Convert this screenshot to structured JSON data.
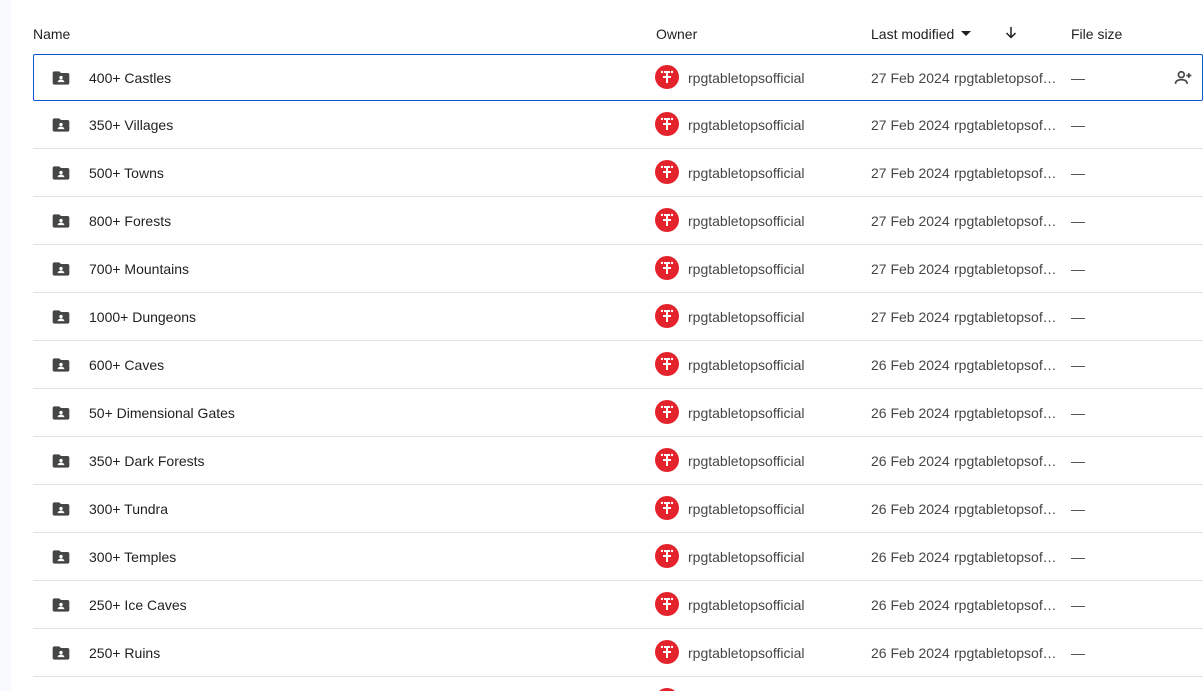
{
  "colors": {
    "accent": "#0b57d0",
    "avatar_red": "#e3222b",
    "folder": "#444746",
    "divider": "#e1e3e1"
  },
  "header": {
    "name": "Name",
    "owner": "Owner",
    "last_modified": "Last modified",
    "sort_icon": "arrow-down-icon",
    "file_size": "File size"
  },
  "rows": [
    {
      "name": "400+ Castles",
      "owner": "rpgtabletopsofficial",
      "date": "27 Feb 2024",
      "modified_by": "rpgtabletopsofficial",
      "size": "—",
      "selected": true
    },
    {
      "name": "350+ Villages",
      "owner": "rpgtabletopsofficial",
      "date": "27 Feb 2024",
      "modified_by": "rpgtabletopsofficial",
      "size": "—"
    },
    {
      "name": "500+ Towns",
      "owner": "rpgtabletopsofficial",
      "date": "27 Feb 2024",
      "modified_by": "rpgtabletopsofficial",
      "size": "—"
    },
    {
      "name": "800+ Forests",
      "owner": "rpgtabletopsofficial",
      "date": "27 Feb 2024",
      "modified_by": "rpgtabletopsofficial",
      "size": "—"
    },
    {
      "name": "700+ Mountains",
      "owner": "rpgtabletopsofficial",
      "date": "27 Feb 2024",
      "modified_by": "rpgtabletopsofficial",
      "size": "—"
    },
    {
      "name": "1000+ Dungeons",
      "owner": "rpgtabletopsofficial",
      "date": "27 Feb 2024",
      "modified_by": "rpgtabletopsofficial",
      "size": "—"
    },
    {
      "name": "600+ Caves",
      "owner": "rpgtabletopsofficial",
      "date": "26 Feb 2024",
      "modified_by": "rpgtabletopsofficial",
      "size": "—"
    },
    {
      "name": "50+ Dimensional Gates",
      "owner": "rpgtabletopsofficial",
      "date": "26 Feb 2024",
      "modified_by": "rpgtabletopsofficial",
      "size": "—"
    },
    {
      "name": "350+ Dark Forests",
      "owner": "rpgtabletopsofficial",
      "date": "26 Feb 2024",
      "modified_by": "rpgtabletopsofficial",
      "size": "—"
    },
    {
      "name": "300+ Tundra",
      "owner": "rpgtabletopsofficial",
      "date": "26 Feb 2024",
      "modified_by": "rpgtabletopsofficial",
      "size": "—"
    },
    {
      "name": "300+ Temples",
      "owner": "rpgtabletopsofficial",
      "date": "26 Feb 2024",
      "modified_by": "rpgtabletopsofficial",
      "size": "—"
    },
    {
      "name": "250+ Ice Caves",
      "owner": "rpgtabletopsofficial",
      "date": "26 Feb 2024",
      "modified_by": "rpgtabletopsofficial",
      "size": "—"
    },
    {
      "name": "250+ Ruins",
      "owner": "rpgtabletopsofficial",
      "date": "26 Feb 2024",
      "modified_by": "rpgtabletopsofficial",
      "size": "—"
    }
  ],
  "row_icons": {
    "folder": "shared-folder-icon",
    "avatar": "owner-avatar-icon",
    "share": "add-person-icon"
  }
}
